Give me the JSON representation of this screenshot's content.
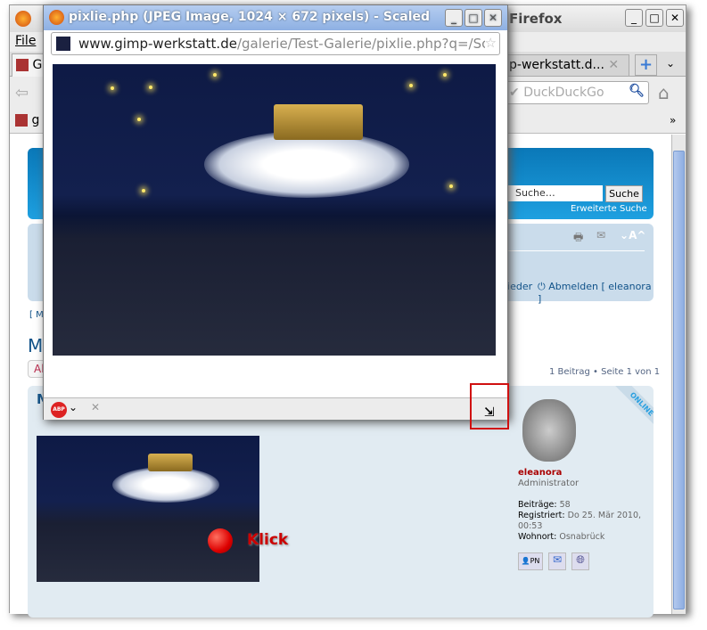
{
  "main_window": {
    "title": "Firefox",
    "menu_file": "File",
    "tab_visible": "G",
    "tab2": "p-werkstatt.d...",
    "search_placeholder": "DuckDuckGo",
    "bookmark_text": "g",
    "bookmark_more": "»"
  },
  "forum": {
    "search_placeholder": "Suche…",
    "search_button": "Suche",
    "advanced_search": "Erweiterte Suche",
    "font_size": "A",
    "members_link": "lieder",
    "logout": "Abmelden",
    "user_bracket": "[ eleanora ]",
    "bracket_link": "[ Mo",
    "heading": "M",
    "button_partial": "Al",
    "pagination": "1 Beitrag • Seite 1 von 1",
    "post_title": "M"
  },
  "post": {
    "click_label": "Klick",
    "online_badge": "ONLINE",
    "username": "eleanora",
    "rank": "Administrator",
    "posts_label": "Beiträge:",
    "posts_value": "58",
    "registered_label": "Registriert:",
    "registered_value": "Do 25. Mär 2010, 00:53",
    "location_label": "Wohnort:",
    "location_value": "Osnabrück",
    "pm_label": "PN"
  },
  "popup": {
    "title": "pixlie.php (JPEG Image, 1024 × 672 pixels) - Scaled",
    "url_domain": "www.gimp-werkstatt.de",
    "url_path": "/galerie/Test-Galerie/pixlie.php?q=/Sc",
    "abp": "ABP"
  },
  "colors": {
    "forum_blue": "#105289",
    "highlight_red": "#cc0000"
  }
}
